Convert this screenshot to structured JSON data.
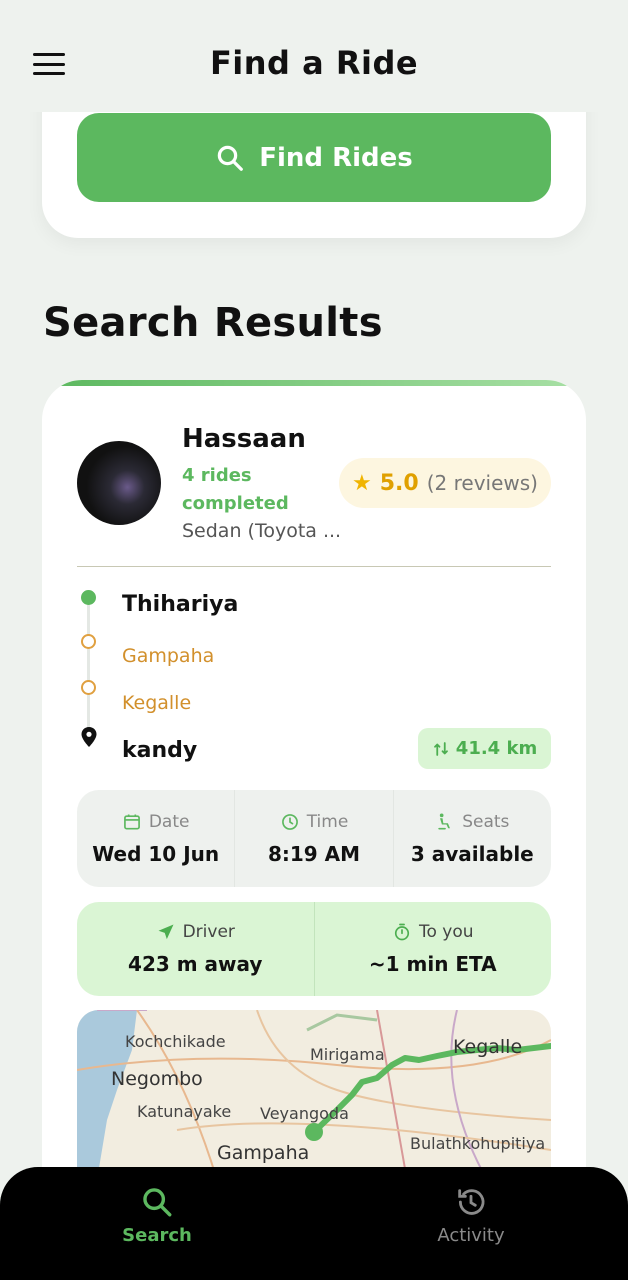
{
  "header": {
    "title": "Find a Ride"
  },
  "search": {
    "button_label": "Find Rides"
  },
  "results": {
    "title": "Search Results"
  },
  "ride": {
    "driver_name": "Hassaan",
    "rides_completed": "4 rides completed",
    "vehicle": "Sedan (Toyota ...",
    "rating": "5.0",
    "reviews": "(2 reviews)",
    "route": {
      "start": "Thihariya",
      "stops": [
        "Gampaha",
        "Kegalle"
      ],
      "end": "kandy"
    },
    "distance": "41.4 km",
    "info": {
      "date_label": "Date",
      "date_value": "Wed 10 Jun",
      "time_label": "Time",
      "time_value": "8:19 AM",
      "seats_label": "Seats",
      "seats_value": "3 available"
    },
    "eta": {
      "driver_label": "Driver",
      "driver_value": "423 m away",
      "toyou_label": "To you",
      "toyou_value": "~1 min ETA"
    },
    "map_labels": [
      "Kochchikade",
      "Negombo",
      "Katunayake",
      "Mirigama",
      "Veyangoda",
      "Gampaha",
      "Kegalle",
      "Bulathkohupitiya"
    ]
  },
  "nav": {
    "search_label": "Search",
    "activity_label": "Activity"
  },
  "colors": {
    "accent": "#5cb85f",
    "stop": "#d2902c",
    "rating": "#e0a000"
  }
}
